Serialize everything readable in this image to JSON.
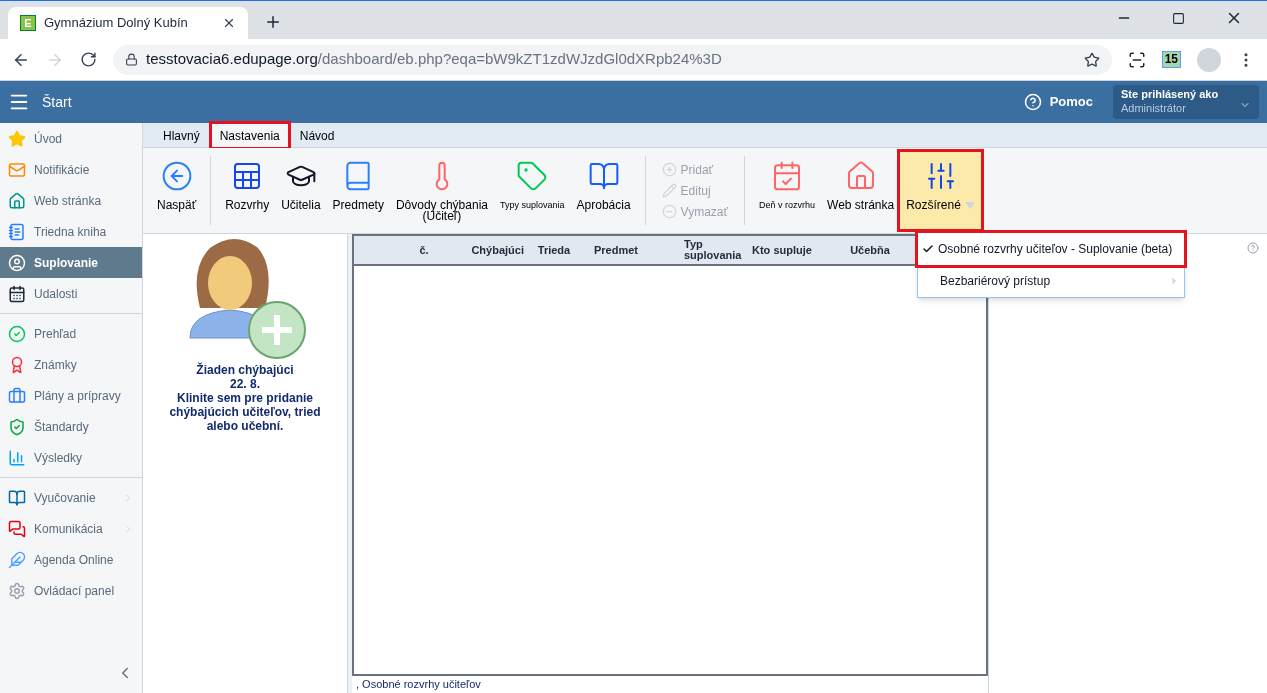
{
  "browser": {
    "tab_title": "Gymnázium Dolný Kubín",
    "favicon_letter": "E",
    "url_host": "tesstovacia6.edupage.org",
    "url_path": "/dashboard/eb.php?eqa=bW9kZT1zdWJzdGl0dXRpb24%3D",
    "extension_badge": "15"
  },
  "header": {
    "menu_label": "Štart",
    "help_label": "Pomoc",
    "user_caption": "Ste prihlásený ako",
    "user_name": "Administrátor"
  },
  "sidebar": {
    "groups": [
      [
        {
          "label": "Úvod",
          "selected": false,
          "has_submenu": false
        },
        {
          "label": "Notifikácie",
          "selected": false,
          "has_submenu": false
        },
        {
          "label": "Web stránka",
          "selected": false,
          "has_submenu": false
        },
        {
          "label": "Triedna kniha",
          "selected": false,
          "has_submenu": false
        },
        {
          "label": "Suplovanie",
          "selected": true,
          "has_submenu": false
        },
        {
          "label": "Udalosti",
          "selected": false,
          "has_submenu": false
        }
      ],
      [
        {
          "label": "Prehľad",
          "selected": false,
          "has_submenu": false
        },
        {
          "label": "Známky",
          "selected": false,
          "has_submenu": false
        },
        {
          "label": "Plány a prípravy",
          "selected": false,
          "has_submenu": false
        },
        {
          "label": "Štandardy",
          "selected": false,
          "has_submenu": false
        },
        {
          "label": "Výsledky",
          "selected": false,
          "has_submenu": false
        }
      ],
      [
        {
          "label": "Vyučovanie",
          "selected": false,
          "has_submenu": true
        },
        {
          "label": "Komunikácia",
          "selected": false,
          "has_submenu": true
        },
        {
          "label": "Agenda Online",
          "selected": false,
          "has_submenu": false
        },
        {
          "label": "Ovládací panel",
          "selected": false,
          "has_submenu": false
        }
      ]
    ]
  },
  "ribbon": {
    "tabs": [
      {
        "label": "Hlavný",
        "selected": false,
        "highlighted": false
      },
      {
        "label": "Nastavenia",
        "selected": true,
        "highlighted": true
      },
      {
        "label": "Návod",
        "selected": false,
        "highlighted": false
      }
    ],
    "tools": [
      {
        "kind": "large",
        "label": "Naspäť",
        "highlighted": false
      },
      {
        "kind": "separator"
      },
      {
        "kind": "large",
        "label": "Rozvrhy",
        "highlighted": false
      },
      {
        "kind": "large",
        "label": "Učitelia",
        "highlighted": false
      },
      {
        "kind": "large",
        "label": "Predmety",
        "highlighted": false
      },
      {
        "kind": "large",
        "label": "Dôvody chýbania",
        "sublabel": "(Učiteľ)",
        "highlighted": false
      },
      {
        "kind": "large",
        "label": "Typy suplovania",
        "small_text": true,
        "highlighted": false
      },
      {
        "kind": "large",
        "label": "Aprobácia",
        "highlighted": false
      },
      {
        "kind": "separator"
      },
      {
        "kind": "stack",
        "items": [
          {
            "label": "Pridať",
            "disabled": true
          },
          {
            "label": "Edituj",
            "disabled": true
          },
          {
            "label": "Vymazať",
            "disabled": true
          }
        ]
      },
      {
        "kind": "separator"
      },
      {
        "kind": "large",
        "label": "Deň v rozvrhu",
        "small_text": true,
        "highlighted": false
      },
      {
        "kind": "large",
        "label": "Web stránka",
        "highlighted": false
      },
      {
        "kind": "dropdown",
        "label": "Rozšírené",
        "highlighted": true,
        "expanded": true
      }
    ]
  },
  "dropdown_menu": {
    "items": [
      {
        "label": "Osobné rozvrhy učiteľov - Suplovanie (beta)",
        "checked": true,
        "has_submenu": false,
        "highlighted": true
      },
      {
        "label": "Bezbariérový prístup",
        "checked": false,
        "has_submenu": true,
        "highlighted": false
      }
    ]
  },
  "absent_panel": {
    "title": "Žiaden chýbajúci",
    "date": "22. 8.",
    "hint": "Klinite sem pre pridanie chýbajúcich učiteľov, tried alebo učební."
  },
  "table": {
    "columns": [
      "č.",
      "Chýbajúci",
      "Trieda",
      "Predmet",
      "Typ suplovania",
      "Kto supluje",
      "Učebňa"
    ]
  },
  "footer_note": ", Osobné rozvrhy učiteľov"
}
